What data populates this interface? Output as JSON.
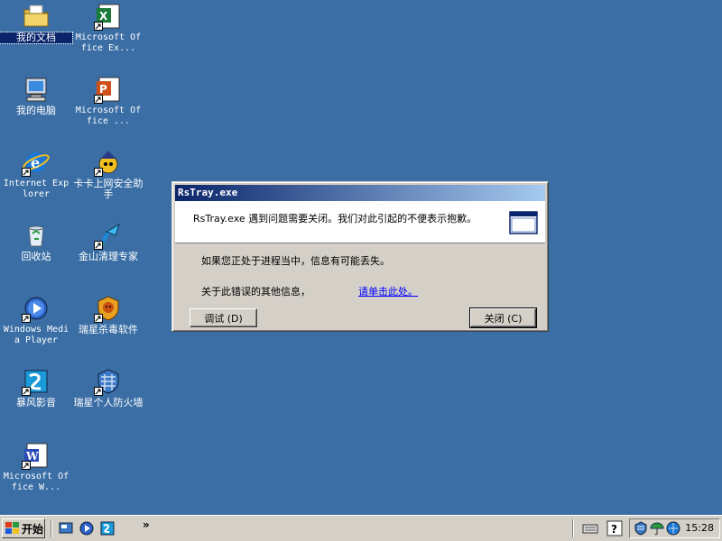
{
  "desktop": {
    "icons": [
      {
        "label": "我的文档"
      },
      {
        "label": "Microsoft Office Ex..."
      },
      {
        "label": "我的电脑"
      },
      {
        "label": "Microsoft Office ..."
      },
      {
        "label": "Internet Explorer"
      },
      {
        "label": "卡卡上网安全助手"
      },
      {
        "label": "回收站"
      },
      {
        "label": "金山清理专家"
      },
      {
        "label": "Windows Media Player"
      },
      {
        "label": "瑞星杀毒软件"
      },
      {
        "label": "暴风影音"
      },
      {
        "label": "瑞星个人防火墙"
      },
      {
        "label": "Microsoft Office W..."
      }
    ]
  },
  "dialog": {
    "title": "RsTray.exe",
    "message": "RsTray.exe 遇到问题需要关闭。我们对此引起的不便表示抱歉。",
    "info_line": "如果您正处于进程当中，信息有可能丢失。",
    "error_info_label": "关于此错误的其他信息，",
    "error_info_link": "请单击此处。",
    "debug_button": "调试 (D)",
    "close_button": "关闭 (C)"
  },
  "taskbar": {
    "start_label": "开始",
    "clock": "15:28",
    "more_indicator": "»"
  },
  "colors": {
    "desktop": "#3a6ea5",
    "title_active_start": "#0a246a",
    "title_active_end": "#a6caf0",
    "face": "#d4d0c8",
    "link": "#0000ff"
  }
}
